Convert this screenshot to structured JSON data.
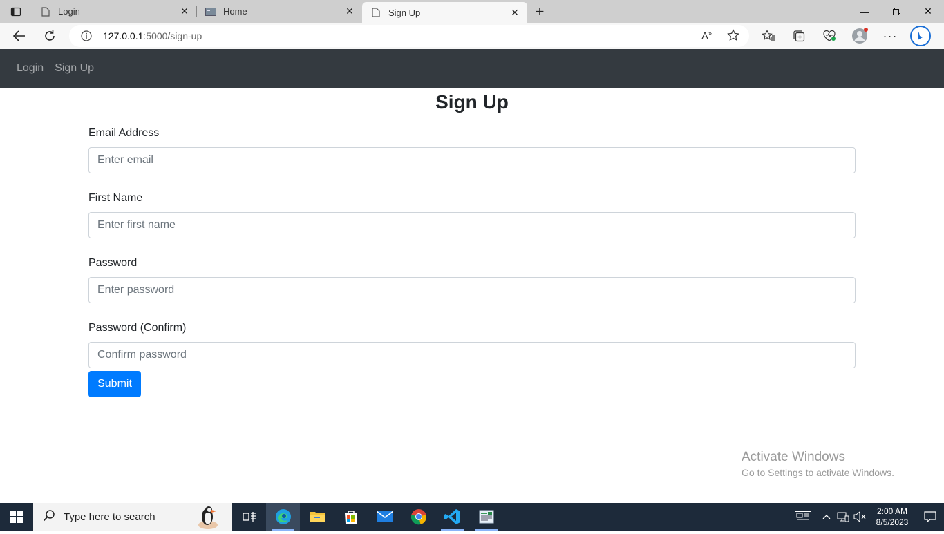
{
  "browser": {
    "tabs": [
      {
        "title": "Login"
      },
      {
        "title": "Home"
      },
      {
        "title": "Sign Up"
      }
    ],
    "url_host": "127.0.0.1",
    "url_path": ":5000/sign-up"
  },
  "navbar": {
    "links": [
      {
        "label": "Login"
      },
      {
        "label": "Sign Up"
      }
    ]
  },
  "form": {
    "title": "Sign Up",
    "fields": [
      {
        "label": "Email Address",
        "placeholder": "Enter email"
      },
      {
        "label": "First Name",
        "placeholder": "Enter first name"
      },
      {
        "label": "Password",
        "placeholder": "Enter password"
      },
      {
        "label": "Password (Confirm)",
        "placeholder": "Confirm password"
      }
    ],
    "submit_label": "Submit"
  },
  "watermark": {
    "line1": "Activate Windows",
    "line2": "Go to Settings to activate Windows."
  },
  "taskbar": {
    "search_placeholder": "Type here to search",
    "time": "2:00 AM",
    "date": "8/5/2023"
  }
}
